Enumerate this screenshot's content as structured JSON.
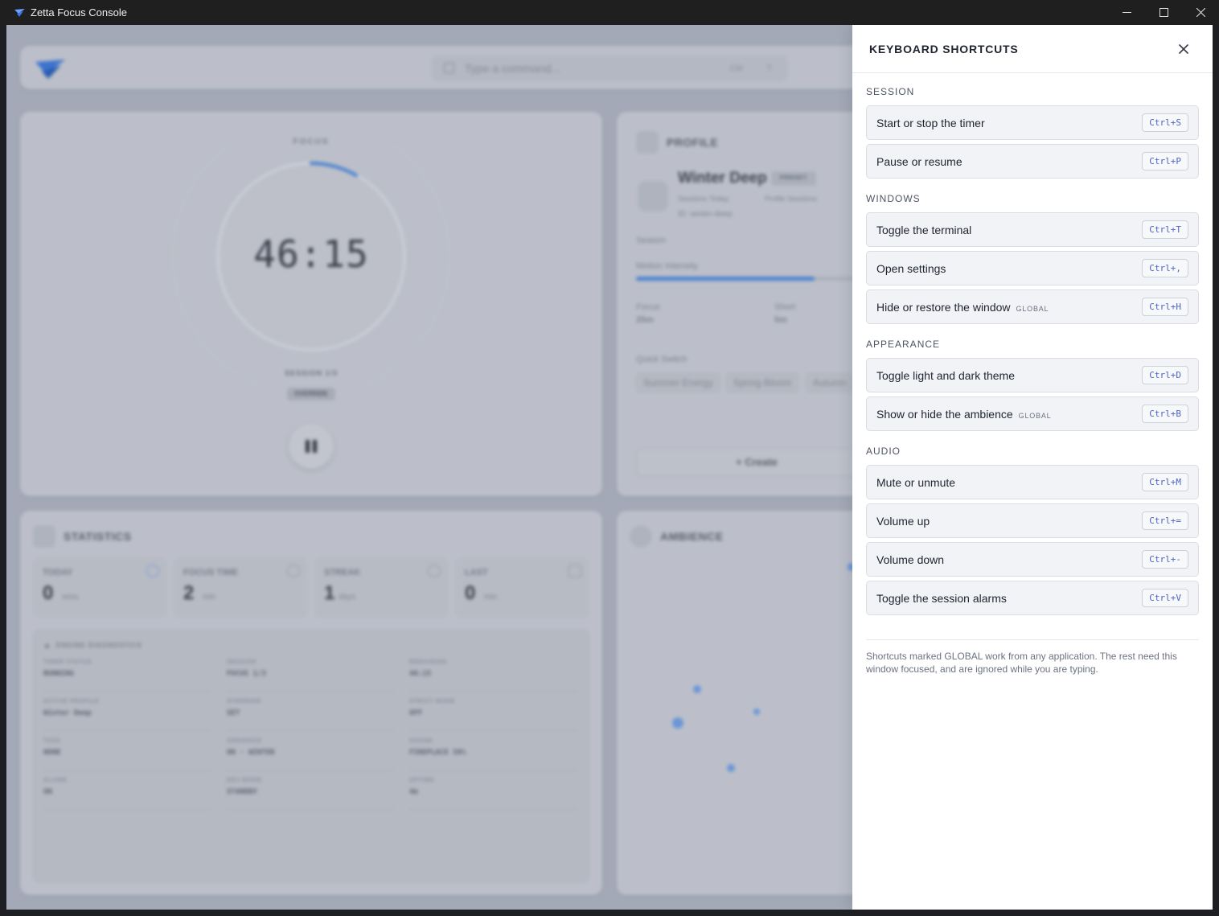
{
  "window": {
    "title": "Zetta Focus Console",
    "minimize_glyph": "—",
    "maximize_glyph": "☐",
    "close_glyph": "✕"
  },
  "background": {
    "command_placeholder": "Type a command...",
    "command_key_1": "Ctrl",
    "command_key_2": "T",
    "focus_label": "FOCUS",
    "timer": "46:15",
    "session_label": "SESSION 1/3",
    "override_label": "OVERRIDE",
    "profile": {
      "section_title": "PROFILE",
      "name": "Winter Deep",
      "preset_badge": "PRESET",
      "sessions_today_label": "Sessions Today:",
      "profile_sessions_label": "Profile Sessions:",
      "id_text": "ID: winter-deep",
      "season_label": "Season",
      "motion_label": "Motion Intensity",
      "motion_level": 0.74,
      "focus_label": "Focus",
      "focus_value": "25m",
      "short_label": "Short",
      "short_value": "5m",
      "quick_switch_label": "Quick Switch",
      "quick_switch": [
        "Summer Energy",
        "Spring Bloom",
        "Autumn"
      ],
      "create_label": "+  Create"
    },
    "statistics": {
      "section_title": "STATISTICS",
      "cards": [
        {
          "label": "TODAY",
          "value": "0",
          "unit": "sess"
        },
        {
          "label": "FOCUS TIME",
          "value": "2",
          "unit": "min"
        },
        {
          "label": "STREAK",
          "value": "1",
          "unit": "days"
        },
        {
          "label": "LAST",
          "value": "0",
          "unit": "min"
        }
      ],
      "diagnostics_title": "ENGINE DIAGNOSTICS",
      "diagnostics": [
        {
          "key": "TIMER STATUS",
          "value": "RUNNING"
        },
        {
          "key": "SESSION",
          "value": "FOCUS 1/3"
        },
        {
          "key": "REMAINING",
          "value": "46:15"
        },
        {
          "key": "ACTIVE PROFILE",
          "value": "Winter Deep"
        },
        {
          "key": "OVERRIDE",
          "value": "SET"
        },
        {
          "key": "STRICT MODE",
          "value": "OFF"
        },
        {
          "key": "TASK",
          "value": "NONE"
        },
        {
          "key": "AMBIENCE",
          "value": "ON · WINTER"
        },
        {
          "key": "SOUND",
          "value": "FIREPLACE 50%"
        },
        {
          "key": "ALARM",
          "value": "ON"
        },
        {
          "key": "DEV MODE",
          "value": "STANDBY"
        },
        {
          "key": "UPTIME",
          "value": "4m"
        }
      ]
    },
    "ambience": {
      "section_title": "AMBIENCE"
    }
  },
  "drawer": {
    "title": "KEYBOARD SHORTCUTS",
    "close_glyph": "✕",
    "groups": [
      {
        "title": "SESSION",
        "items": [
          {
            "label": "Start or stop the timer",
            "badge": "",
            "key": "Ctrl+S"
          },
          {
            "label": "Pause or resume",
            "badge": "",
            "key": "Ctrl+P"
          }
        ]
      },
      {
        "title": "WINDOWS",
        "items": [
          {
            "label": "Toggle the terminal",
            "badge": "",
            "key": "Ctrl+T"
          },
          {
            "label": "Open settings",
            "badge": "",
            "key": "Ctrl+,"
          },
          {
            "label": "Hide or restore the window",
            "badge": "GLOBAL",
            "key": "Ctrl+H"
          }
        ]
      },
      {
        "title": "APPEARANCE",
        "items": [
          {
            "label": "Toggle light and dark theme",
            "badge": "",
            "key": "Ctrl+D"
          },
          {
            "label": "Show or hide the ambience",
            "badge": "GLOBAL",
            "key": "Ctrl+B"
          }
        ]
      },
      {
        "title": "AUDIO",
        "items": [
          {
            "label": "Mute or unmute",
            "badge": "",
            "key": "Ctrl+M"
          },
          {
            "label": "Volume up",
            "badge": "",
            "key": "Ctrl+="
          },
          {
            "label": "Volume down",
            "badge": "",
            "key": "Ctrl+-"
          },
          {
            "label": "Toggle the session alarms",
            "badge": "",
            "key": "Ctrl+V"
          }
        ]
      }
    ],
    "footer_note": "Shortcuts marked GLOBAL work from any application. The rest need this window focused, and are ignored while you are typing."
  },
  "colors": {
    "accent": "#4a86d8",
    "key_text": "#4d63c7",
    "drawer_bg": "#ffffff",
    "overlay_bg": "#aab0be"
  }
}
